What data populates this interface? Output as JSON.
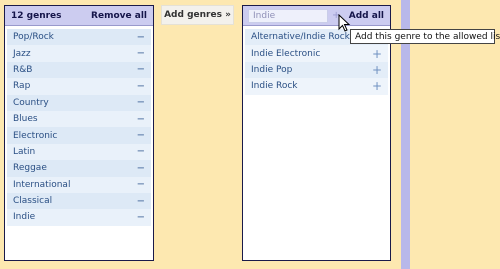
{
  "left": {
    "count_label": "12 genres",
    "remove_all": "Remove all",
    "genres": [
      "Pop/Rock",
      "Jazz",
      "R&B",
      "Rap",
      "Country",
      "Blues",
      "Electronic",
      "Latin",
      "Reggae",
      "International",
      "Classical",
      "Indie"
    ],
    "remove_icon": "−"
  },
  "add_genres_button": "Add genres »",
  "middle": {
    "search_value": "Indie",
    "add_all": "Add all",
    "small_plus": "+",
    "results": [
      "Alternative/Indie Rock",
      "Indie Electronic",
      "Indie Pop",
      "Indie Rock"
    ],
    "add_icon": "+"
  },
  "tooltip": "Add this genre to the allowed list",
  "colors": {
    "background": "#fde8b0",
    "header": "#ccccf0",
    "row": "#dde9f6",
    "stripe": "#b8b8ea"
  }
}
